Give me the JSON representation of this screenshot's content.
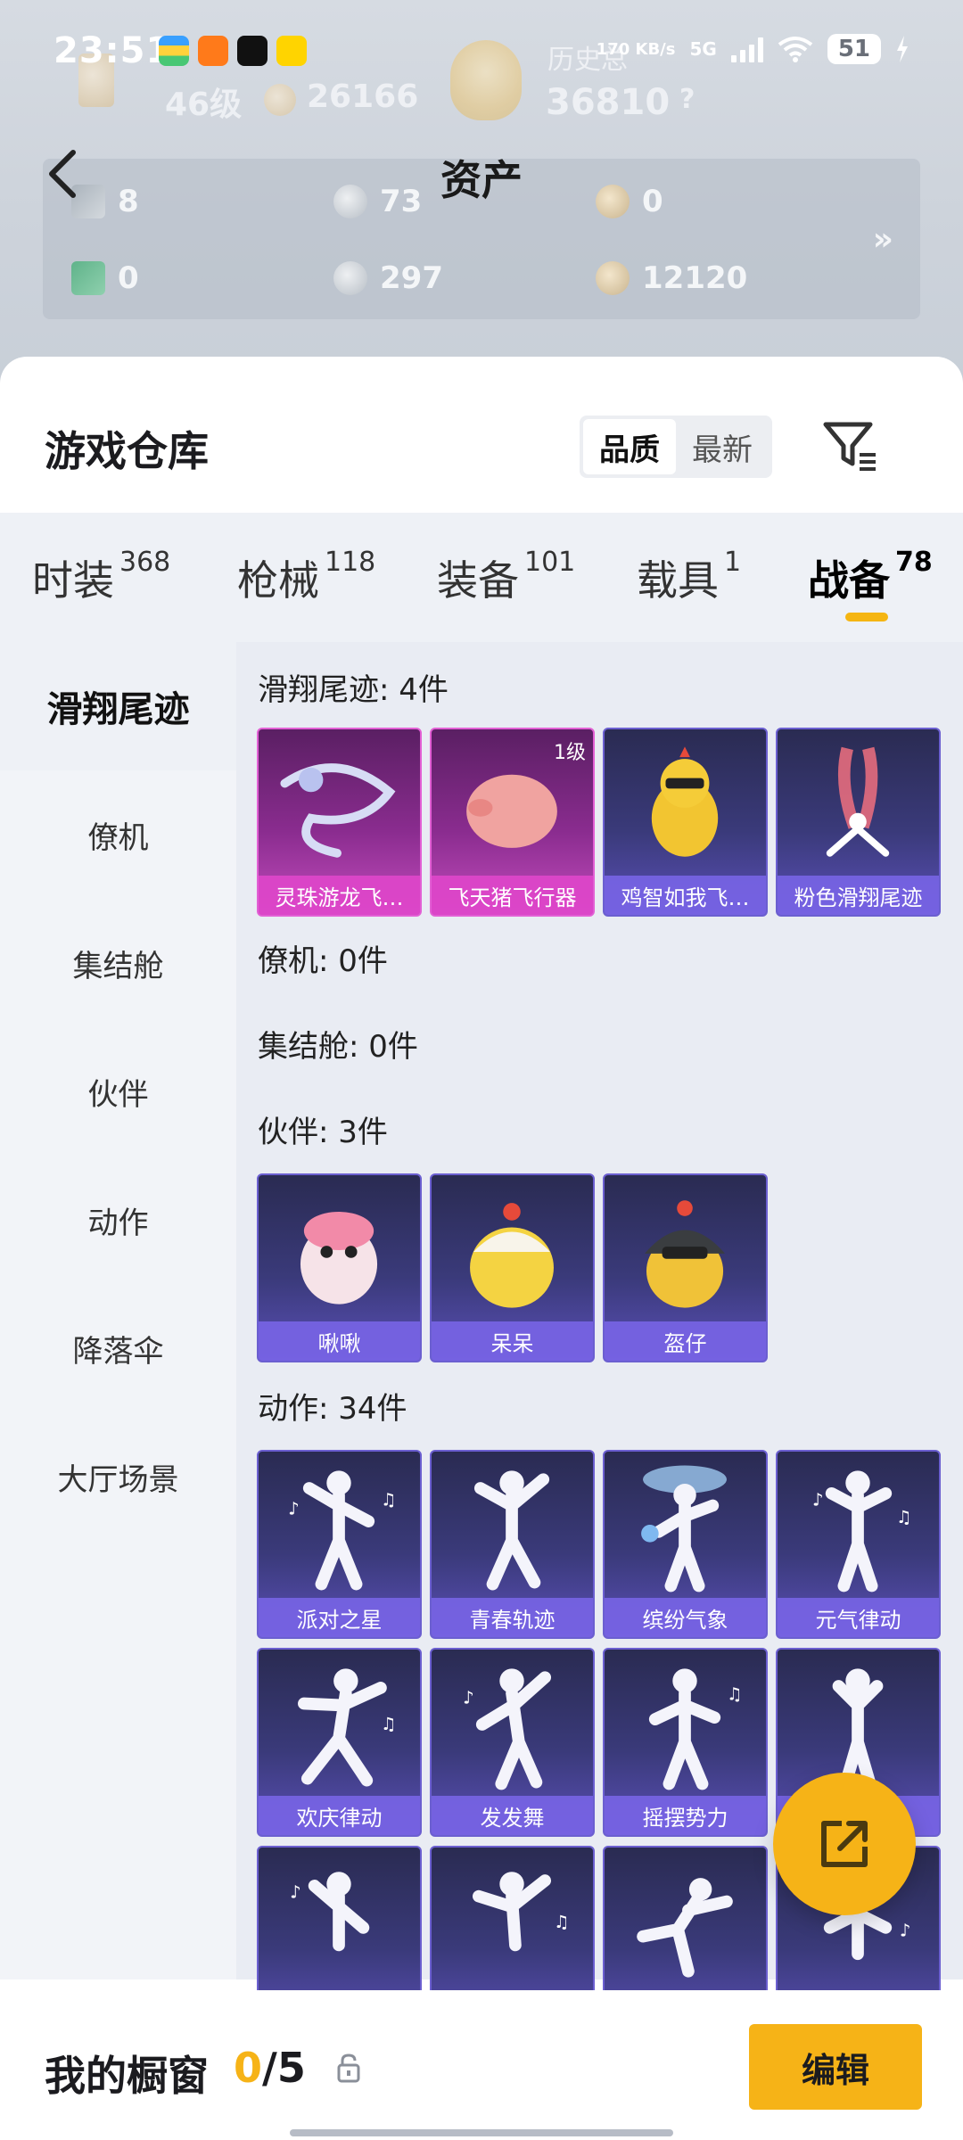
{
  "status_bar": {
    "time": "23:51",
    "network_speed": "170 KB/s",
    "network_type": "5G",
    "battery": "51"
  },
  "header": {
    "back_icon": "chevron-left-icon",
    "title": "资产",
    "faint_texts": [
      "历史总",
      "46级",
      "26166",
      "36810",
      "?"
    ],
    "assets_row1": [
      "8",
      "73",
      "0"
    ],
    "assets_row2": [
      "0",
      "297",
      "12120"
    ],
    "more": "»"
  },
  "sheet": {
    "title": "游戏仓库",
    "sort_options": [
      "品质",
      "最新"
    ],
    "sort_active": "品质",
    "filter_icon": "filter-icon"
  },
  "categories": [
    {
      "label": "时装",
      "count": "368"
    },
    {
      "label": "枪械",
      "count": "118"
    },
    {
      "label": "装备",
      "count": "101"
    },
    {
      "label": "载具",
      "count": "1"
    },
    {
      "label": "战备",
      "count": "78",
      "active": true
    }
  ],
  "side_nav": [
    "滑翔尾迹",
    "僚机",
    "集结舱",
    "伙伴",
    "动作",
    "降落伞",
    "大厅场景"
  ],
  "side_nav_active": "滑翔尾迹",
  "sections": {
    "glide": {
      "title": "滑翔尾迹: 4件",
      "items": [
        {
          "name": "灵珠游龙飞…",
          "quality": "pink"
        },
        {
          "name": "飞天猪飞行器",
          "quality": "pink",
          "level": "1级"
        },
        {
          "name": "鸡智如我飞…",
          "quality": "purple"
        },
        {
          "name": "粉色滑翔尾迹",
          "quality": "purple"
        }
      ]
    },
    "wingman": {
      "title": "僚机: 0件"
    },
    "pod": {
      "title": "集结舱: 0件"
    },
    "partner": {
      "title": "伙伴: 3件",
      "items": [
        {
          "name": "啾啾"
        },
        {
          "name": "呆呆"
        },
        {
          "name": "盔仔"
        }
      ]
    },
    "action": {
      "title": "动作: 34件",
      "items": [
        {
          "name": "派对之星"
        },
        {
          "name": "青春轨迹"
        },
        {
          "name": "缤纷气象"
        },
        {
          "name": "元气律动"
        },
        {
          "name": "欢庆律动"
        },
        {
          "name": "发发舞"
        },
        {
          "name": "摇摆势力"
        },
        {
          "name": ""
        }
      ]
    }
  },
  "fab_icon": "share-external-icon",
  "bottom": {
    "label": "我的橱窗",
    "current": "0",
    "total": "/5",
    "lock_icon": "lock-icon",
    "edit": "编辑"
  }
}
